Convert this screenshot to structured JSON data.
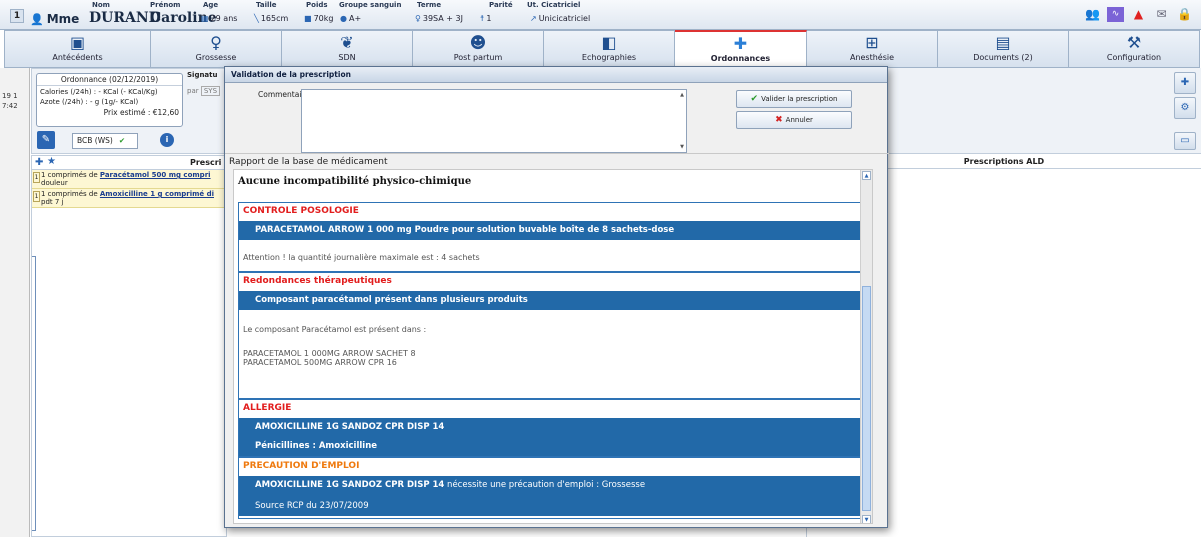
{
  "header": {
    "patient_number": "1",
    "civility": "Mme",
    "nom_label": "Nom",
    "nom": "DURAND",
    "prenom_label": "Prénom",
    "prenom": "Caroline",
    "age_label": "Age",
    "age": "29 ans",
    "taille_label": "Taille",
    "taille": "165cm",
    "poids_label": "Poids",
    "poids": "70kg",
    "groupe_label": "Groupe sanguin",
    "groupe": "A+",
    "terme_label": "Terme",
    "terme": "39SA + 3J",
    "parite_label": "Parité",
    "parite": "1",
    "ut_label": "Ut. Cicatriciel",
    "ut": "Unicicatriciel"
  },
  "tabs": [
    {
      "label": "Antécédents",
      "icon": "calendar-icon"
    },
    {
      "label": "Grossesse",
      "icon": "pregnancy-icon"
    },
    {
      "label": "SDN",
      "icon": "feet-icon"
    },
    {
      "label": "Post partum",
      "icon": "family-icon"
    },
    {
      "label": "Echographies",
      "icon": "ultrasound-icon"
    },
    {
      "label": "Ordonnances",
      "icon": "medical-cross-icon"
    },
    {
      "label": "Anesthésie",
      "icon": "anesthesia-icon"
    },
    {
      "label": "Documents (2)",
      "icon": "documents-icon"
    },
    {
      "label": "Configuration",
      "icon": "wrench-icon"
    }
  ],
  "active_tab": "Ordonnances",
  "left_strip": {
    "line1": "19 1",
    "line2": "7:42"
  },
  "ordonnance": {
    "title": "Ordonnance (02/12/2019)",
    "calories": "Calories (/24h) : - KCal (- KCal/Kg)",
    "azote": "Azote (/24h) : - g (1g/- KCal)",
    "prix": "Prix estimé : €12,60",
    "signature_label": "Signatu",
    "par_label": "par",
    "par_value": "SYS",
    "bcb_label": "BCB (WS)"
  },
  "prescriptions": {
    "header_label": "Prescri",
    "items": [
      {
        "qty": "1",
        "prefix": "1 comprimés de",
        "drug": "Paracétamol 500 mg compri",
        "detail": "douleur"
      },
      {
        "qty": "1",
        "prefix": "1 comprimés de",
        "drug": "Amoxicilline 1 g comprimé di",
        "detail": "pdt 7 j"
      }
    ]
  },
  "right_pane": {
    "header": "Prescriptions ALD"
  },
  "modal": {
    "title": "Validation de la prescription",
    "comment_label": "Commentaire",
    "validate_label": "Valider la prescription",
    "cancel_label": "Annuler",
    "report_title": "Rapport de la base de médicament",
    "no_incompat": "Aucune incompatibilité physico-chimique",
    "sections": {
      "posologie": {
        "title": "CONTROLE POSOLOGIE",
        "bar": "PARACETAMOL ARROW 1 000 mg Poudre pour solution buvable boîte de 8 sachets-dose",
        "text": "Attention ! la quantité journalière maximale est : 4 sachets"
      },
      "redondances": {
        "title": "Redondances thérapeutiques",
        "bar": "Composant paracétamol présent dans plusieurs produits",
        "text1": "Le composant Paracétamol est présent dans :",
        "text2": "PARACETAMOL 1 000MG ARROW SACHET 8",
        "text3": "PARACETAMOL 500MG ARROW CPR 16"
      },
      "allergie": {
        "title": "ALLERGIE",
        "bar1": "AMOXICILLINE 1G SANDOZ CPR DISP 14",
        "bar2": "Pénicillines : Amoxicilline"
      },
      "precaution": {
        "title": "PRECAUTION D'EMPLOI",
        "bar1_bold": "AMOXICILLINE 1G SANDOZ CPR DISP 14",
        "bar1_rest": " nécessite une précaution d'emploi : Grossesse",
        "bar2": "Source RCP du 23/07/2009"
      }
    }
  },
  "colors": {
    "accent_blue": "#2269a8",
    "alert_red": "#e21d1d",
    "warning_orange": "#ef7a0f",
    "prescription_yellow": "#fdf7d3"
  }
}
